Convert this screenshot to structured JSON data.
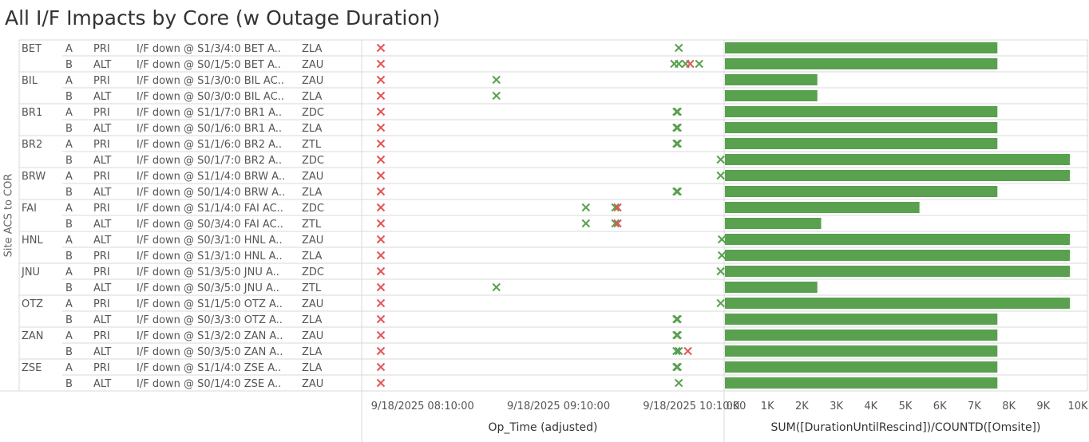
{
  "title": "All I/F Impacts by Core (w Outage Duration)",
  "y_axis_label": "Site ACS to COR",
  "colors": {
    "red_marker": "#e15759",
    "green_marker": "#59a14f",
    "grid": "#d9d9d9",
    "bar": "#59a14f"
  },
  "chart_data": {
    "type": "table",
    "rows": [
      {
        "site": "BET",
        "side": "A",
        "role": "PRI",
        "event": "I/F down @ S1/3/4:0 BET A..",
        "core": "ZLA"
      },
      {
        "site": "",
        "side": "B",
        "role": "ALT",
        "event": "I/F down @ S0/1/5:0 BET A..",
        "core": "ZAU"
      },
      {
        "site": "BIL",
        "side": "A",
        "role": "PRI",
        "event": "I/F down @ S1/3/0:0 BIL AC..",
        "core": "ZAU"
      },
      {
        "site": "",
        "side": "B",
        "role": "ALT",
        "event": "I/F down @ S0/3/0:0 BIL AC..",
        "core": "ZLA"
      },
      {
        "site": "BR1",
        "side": "A",
        "role": "PRI",
        "event": "I/F down @ S1/1/7:0 BR1 A..",
        "core": "ZDC"
      },
      {
        "site": "",
        "side": "B",
        "role": "ALT",
        "event": "I/F down @ S0/1/6:0 BR1 A..",
        "core": "ZLA"
      },
      {
        "site": "BR2",
        "side": "A",
        "role": "PRI",
        "event": "I/F down @ S1/1/6:0 BR2 A..",
        "core": "ZTL"
      },
      {
        "site": "",
        "side": "B",
        "role": "ALT",
        "event": "I/F down @ S0/1/7:0 BR2 A..",
        "core": "ZDC"
      },
      {
        "site": "BRW",
        "side": "A",
        "role": "PRI",
        "event": "I/F down @ S1/1/4:0 BRW A..",
        "core": "ZAU"
      },
      {
        "site": "",
        "side": "B",
        "role": "ALT",
        "event": "I/F down @ S0/1/4:0 BRW A..",
        "core": "ZLA"
      },
      {
        "site": "FAI",
        "side": "A",
        "role": "PRI",
        "event": "I/F down @ S1/1/4:0 FAI AC..",
        "core": "ZDC"
      },
      {
        "site": "",
        "side": "B",
        "role": "ALT",
        "event": "I/F down @ S0/3/4:0 FAI AC..",
        "core": "ZTL"
      },
      {
        "site": "HNL",
        "side": "A",
        "role": "ALT",
        "event": "I/F down @ S0/3/1:0 HNL A..",
        "core": "ZAU"
      },
      {
        "site": "",
        "side": "B",
        "role": "PRI",
        "event": "I/F down @ S1/3/1:0 HNL A..",
        "core": "ZLA"
      },
      {
        "site": "JNU",
        "side": "A",
        "role": "PRI",
        "event": "I/F down @ S1/3/5:0 JNU A..",
        "core": "ZDC"
      },
      {
        "site": "",
        "side": "B",
        "role": "ALT",
        "event": "I/F down @ S0/3/5:0 JNU A..",
        "core": "ZTL"
      },
      {
        "site": "OTZ",
        "side": "A",
        "role": "PRI",
        "event": "I/F down @ S1/1/5:0 OTZ A..",
        "core": "ZAU"
      },
      {
        "site": "",
        "side": "B",
        "role": "ALT",
        "event": "I/F down @ S0/3/3:0 OTZ A..",
        "core": "ZLA"
      },
      {
        "site": "ZAN",
        "side": "A",
        "role": "PRI",
        "event": "I/F down @ S1/3/2:0 ZAN A..",
        "core": "ZAU"
      },
      {
        "site": "",
        "side": "B",
        "role": "ALT",
        "event": "I/F down @ S0/3/5:0 ZAN A..",
        "core": "ZLA"
      },
      {
        "site": "ZSE",
        "side": "A",
        "role": "PRI",
        "event": "I/F down @ S1/1/4:0 ZSE A..",
        "core": "ZLA"
      },
      {
        "site": "",
        "side": "B",
        "role": "ALT",
        "event": "I/F down @ S0/1/4:0 ZSE A..",
        "core": "ZAU"
      }
    ],
    "timeline": {
      "type": "scatter",
      "xlabel": "Op_Time (adjusted)",
      "ticks": [
        {
          "date": "9/18/2025",
          "time": "08:10:00",
          "minutes": 490
        },
        {
          "date": "9/18/2025",
          "time": "09:10:00",
          "minutes": 550
        },
        {
          "date": "9/18/2025",
          "time": "10:10:00",
          "minutes": 610
        }
      ],
      "xlim_minutes": [
        454,
        650
      ],
      "red_x_minutes": 468,
      "green_marks_minutes": [
        [
          599.5
        ],
        [
          597.5,
          599.5,
          602.5,
          608.5
        ],
        [
          519
        ],
        [
          519
        ],
        [
          598.5,
          599
        ],
        [
          598.5,
          599
        ],
        [
          598.5,
          599
        ],
        [
          618
        ],
        [
          618
        ],
        [
          598.5,
          599
        ],
        [
          558.5,
          571.5
        ],
        [
          558.5,
          571.5
        ],
        [
          618.5
        ],
        [
          618.5
        ],
        [
          618
        ],
        [
          519
        ],
        [
          618
        ],
        [
          598.5,
          599
        ],
        [
          598.5,
          599
        ],
        [
          598.5,
          599.5
        ],
        [
          598.5,
          599
        ],
        [
          599.5
        ]
      ],
      "extra_red_marks_minutes": [
        [],
        [
          604.5
        ],
        [],
        [],
        [],
        [],
        [],
        [],
        [],
        [],
        [
          572.5
        ],
        [
          572.5
        ],
        [],
        [],
        [],
        [],
        [],
        [],
        [],
        [
          603.5
        ],
        [],
        []
      ]
    },
    "bars": {
      "type": "bar",
      "xlabel": "SUM([DurationUntilRescind])/COUNTD([Omsite])",
      "ticks": [
        "0K",
        "1K",
        "2K",
        "3K",
        "4K",
        "5K",
        "6K",
        "7K",
        "8K",
        "9K",
        "10K"
      ],
      "xlim": [
        0,
        10000
      ],
      "values": [
        7900,
        7900,
        2680,
        2680,
        7900,
        7900,
        7900,
        10000,
        10000,
        7900,
        5640,
        2790,
        10000,
        10000,
        10000,
        2680,
        10000,
        7900,
        7900,
        7900,
        7900,
        7900
      ]
    }
  }
}
